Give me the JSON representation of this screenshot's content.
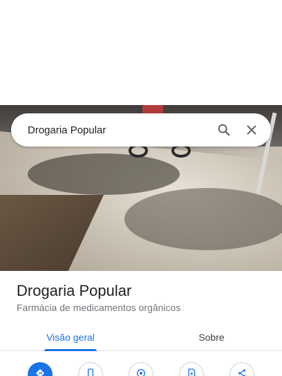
{
  "search": {
    "query": "Drogaria Popular"
  },
  "place": {
    "name": "Drogaria Popular",
    "category": "Farmácia de medicamentos orgânicos"
  },
  "tabs": [
    {
      "label": "Visão geral",
      "active": true
    },
    {
      "label": "Sobre",
      "active": false
    }
  ],
  "actions": [
    {
      "icon": "directions-icon"
    },
    {
      "icon": "phone-icon"
    },
    {
      "icon": "location-icon"
    },
    {
      "icon": "save-icon"
    },
    {
      "icon": "share-icon"
    }
  ],
  "colors": {
    "accent": "#1a73e8",
    "text_primary": "#202124",
    "text_secondary": "#70757a"
  }
}
